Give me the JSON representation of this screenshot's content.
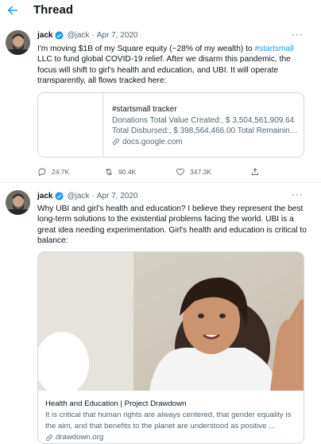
{
  "header": {
    "title": "Thread"
  },
  "tweets": [
    {
      "name": "jack",
      "handle": "@jack",
      "date": "Apr 7, 2020",
      "more": "···",
      "text_a": "I'm moving $1B of my Square equity (~28% of my wealth) to ",
      "hashtag": "#startsmall",
      "text_b": " LLC to fund global COVID-19 relief. After we disarm this pandemic, the focus will shift to girl's health and education, and UBI. It will operate transparently, all flows tracked here:",
      "card": {
        "title": "#startsmall tracker",
        "line1": "Donations Total Value Created:, $ 3,504,561,909.64",
        "line2": "Total Disbursed:, $ 398,564,466.00 Total Remaining:...",
        "link": "docs.google.com"
      },
      "stats": {
        "replies": "24.7K",
        "retweets": "90.4K",
        "likes": "347.3K"
      }
    },
    {
      "name": "jack",
      "handle": "@jack",
      "date": "Apr 7, 2020",
      "more": "···",
      "text": "Why UBI and girl's health and education? I believe they represent the best long-term solutions to the existential problems facing the world. UBI is a great idea needing experimentation. Girl's health and education is critical to balance:",
      "card": {
        "title": "Health and Education | Project Drawdown",
        "desc": "It is critical that human rights are always centered, that gender equality is the aim, and that benefits to the planet are understood as positive ...",
        "link": "drawdown.org"
      }
    }
  ],
  "colors": {
    "accent": "#1d9bf0",
    "muted": "#536471",
    "text": "#0f1419",
    "border": "#cfd9de"
  }
}
